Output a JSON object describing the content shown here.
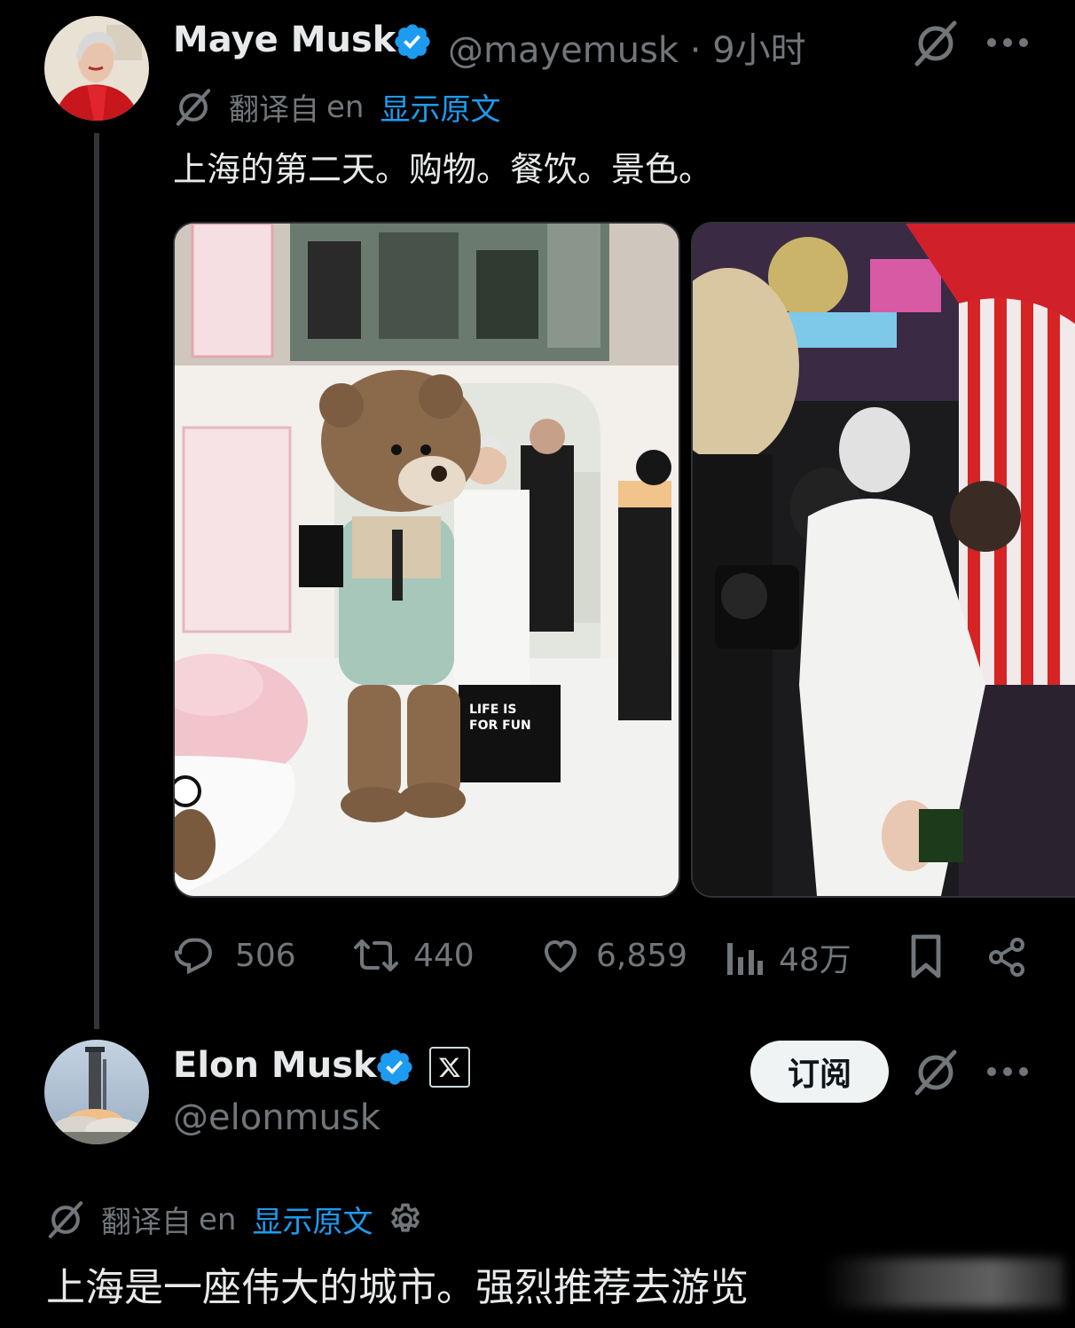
{
  "tweet1": {
    "author": {
      "name": "Maye Musk",
      "handle": "@mayemusk",
      "separator": "·",
      "time": "9小时",
      "verified": true
    },
    "translation": {
      "prefix": "翻译自",
      "lang": "en",
      "show_original": "显示原文"
    },
    "text": "上海的第二天。购物。餐饮。景色。",
    "media_images": [
      {
        "text_on_bag_1": "LIFE IS",
        "text_on_bag_2": "FOR FUN"
      },
      {}
    ],
    "actions": {
      "replies": "506",
      "reposts": "440",
      "likes": "6,859",
      "views": "48万"
    }
  },
  "tweet2": {
    "author": {
      "name": "Elon Musk",
      "handle": "@elonmusk",
      "verified": true
    },
    "subscribe_label": "订阅",
    "translation": {
      "prefix": "翻译自",
      "lang": "en",
      "show_original": "显示原文"
    },
    "text": "上海是一座伟大的城市。强烈推荐去游览"
  },
  "colors": {
    "background": "#000000",
    "text_primary": "#e7e9ea",
    "text_secondary": "#71767b",
    "link": "#1d9bf0",
    "verified_blue": "#1d9bf0",
    "divider": "#2f3336"
  },
  "icons": [
    "grok-icon",
    "more-icon",
    "reply-icon",
    "repost-icon",
    "like-icon",
    "views-icon",
    "bookmark-icon",
    "share-icon",
    "settings-icon",
    "x-logo-icon",
    "verified-badge-icon"
  ]
}
